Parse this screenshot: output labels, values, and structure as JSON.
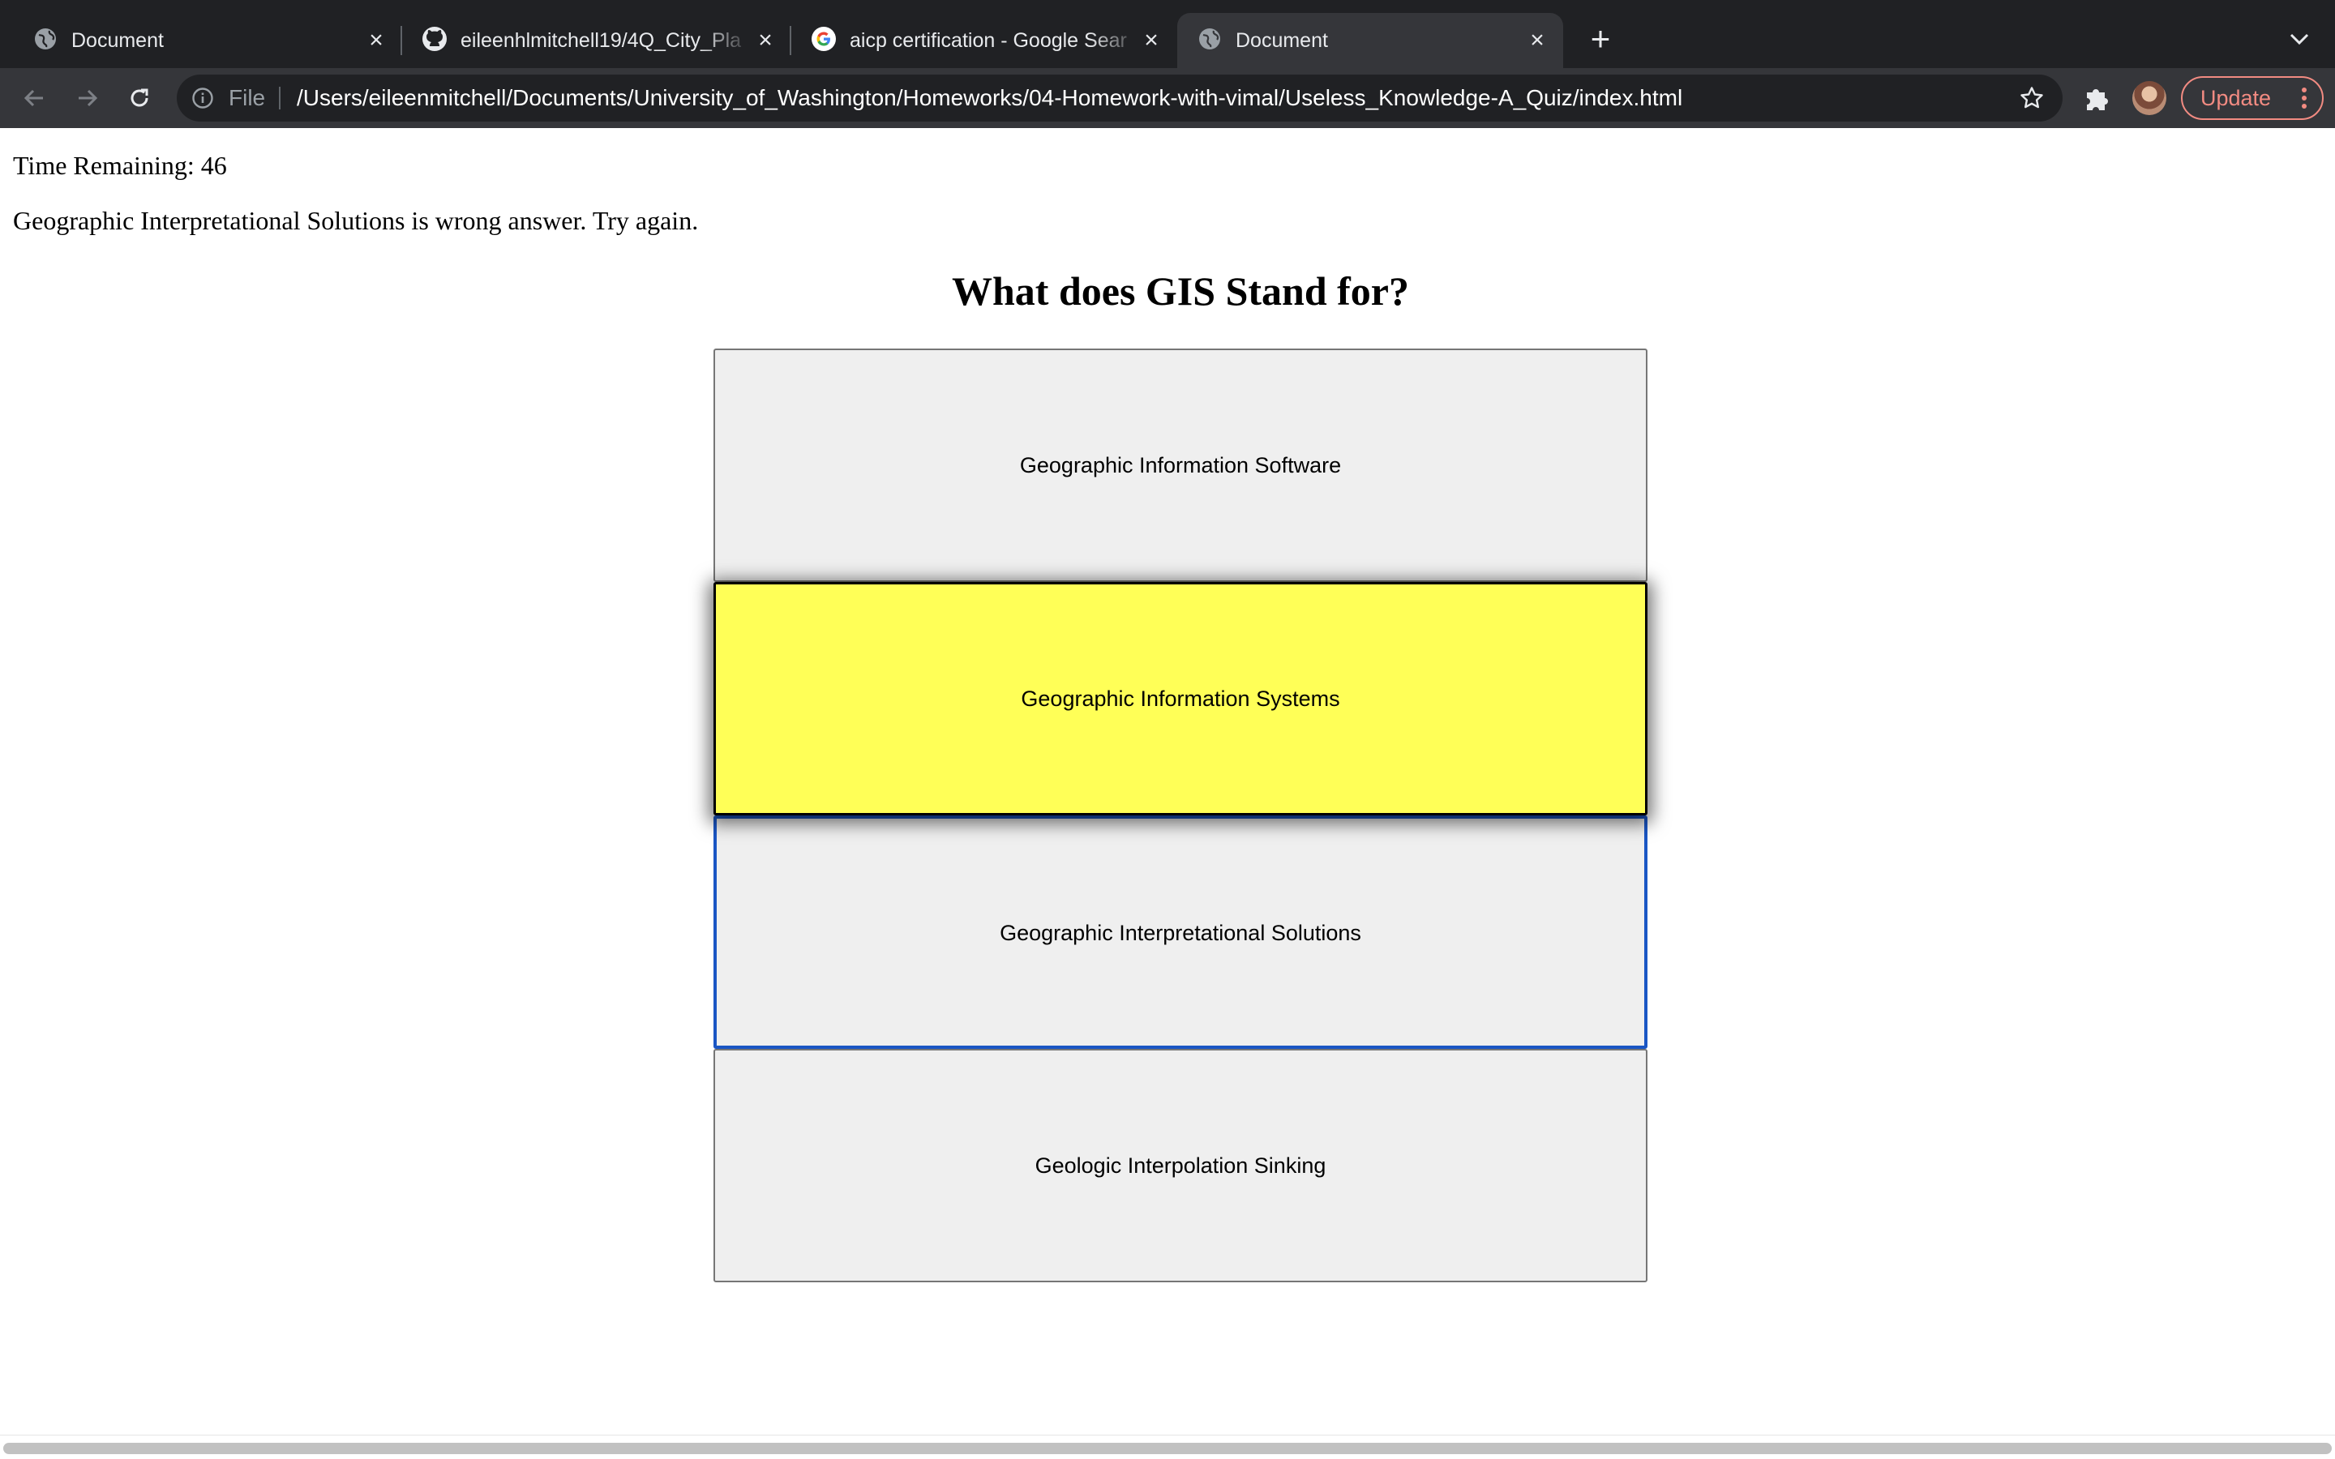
{
  "browser": {
    "tabs": [
      {
        "title": "Document",
        "favicon": "globe-icon",
        "active": false
      },
      {
        "title": "eileenhlmitchell19/4Q_City_Pla",
        "favicon": "github-icon",
        "active": false
      },
      {
        "title": "aicp certification - Google Sear",
        "favicon": "google-icon",
        "active": false
      },
      {
        "title": "Document",
        "favicon": "globe-icon",
        "active": true
      }
    ],
    "new_tab_glyph": "+",
    "close_glyph": "×",
    "address_bar": {
      "scheme_label": "File",
      "url": "/Users/eileenmitchell/Documents/University_of_Washington/Homeworks/04-Homework-with-vimal/Useless_Knowledge-A_Quiz/index.html"
    },
    "update_button_label": "Update"
  },
  "page": {
    "timer_label": "Time Remaining: 46",
    "feedback": "Geographic Interpretational Solutions is wrong answer. Try again.",
    "question": "What does GIS Stand for?",
    "answers": [
      {
        "label": "Geographic Information Software",
        "state": "normal"
      },
      {
        "label": "Geographic Information Systems",
        "state": "hovered"
      },
      {
        "label": "Geographic Interpretational Solutions",
        "state": "focused"
      },
      {
        "label": "Geologic Interpolation Sinking",
        "state": "normal"
      }
    ]
  },
  "colors": {
    "tabstrip_bg": "#202124",
    "toolbar_bg": "#35363a",
    "answer_bg": "#efefef",
    "answer_hover_bg": "#ffff57",
    "focus_ring": "#1a56c4",
    "update_accent": "#f28b82"
  }
}
